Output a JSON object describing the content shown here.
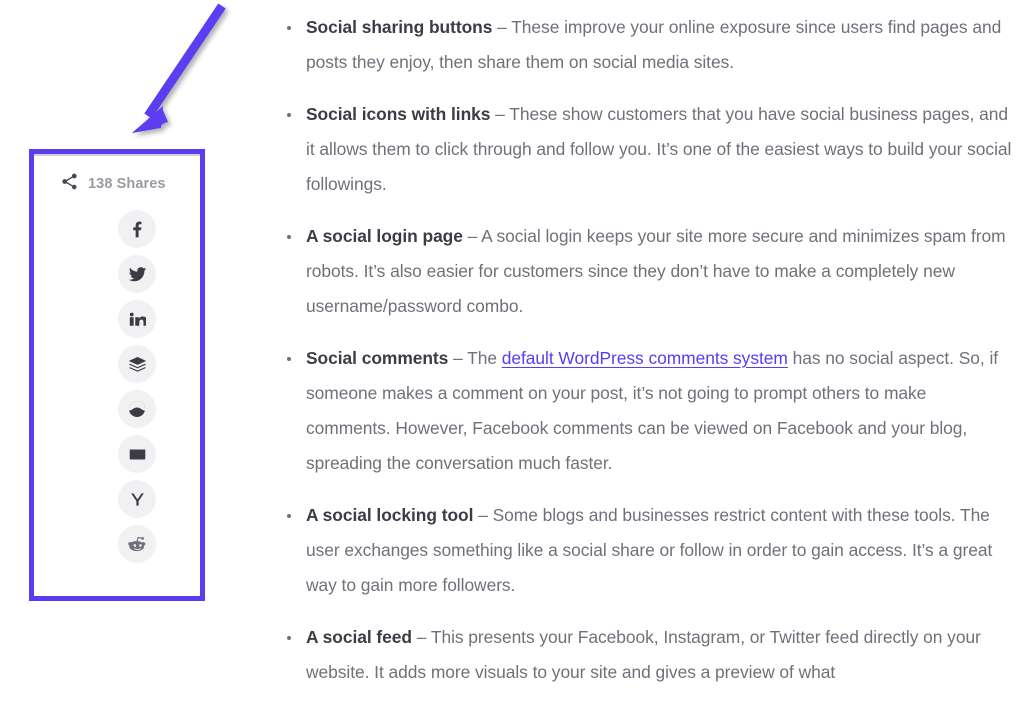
{
  "annotation": {
    "arrow_color": "#5c3cf0",
    "highlight_border_color": "#5c3cf0"
  },
  "share_widget": {
    "share_icon": "share-nodes-icon",
    "share_count_label": "138 Shares",
    "count_text_color": "#9a9aa2",
    "networks": [
      {
        "id": "facebook",
        "label": "f",
        "icon": "facebook-icon"
      },
      {
        "id": "twitter",
        "label": "",
        "icon": "twitter-bird-icon"
      },
      {
        "id": "linkedin",
        "label": "in",
        "icon": "linkedin-icon"
      },
      {
        "id": "buffer",
        "label": "",
        "icon": "buffer-layers-icon"
      },
      {
        "id": "mix",
        "label": "",
        "icon": "mix-circle-icon"
      },
      {
        "id": "email",
        "label": "",
        "icon": "envelope-icon"
      },
      {
        "id": "yummly",
        "label": "Y",
        "icon": "yummly-icon"
      },
      {
        "id": "reddit",
        "label": "",
        "icon": "reddit-alien-icon"
      }
    ]
  },
  "article": {
    "link_color": "#5c3cf0",
    "bullets": [
      {
        "term": "Social sharing buttons",
        "dash": " – ",
        "body_before_link": "These improve your online exposure since users find pages and posts they enjoy, then share them on social media sites.",
        "link_text": "",
        "body_after_link": ""
      },
      {
        "term": "Social icons with links",
        "dash": " – ",
        "body_before_link": "These show customers that you have social business pages, and it allows them to click through and follow you. It’s one of the easiest ways to build your social followings.",
        "link_text": "",
        "body_after_link": ""
      },
      {
        "term": "A social login page",
        "dash": " – ",
        "body_before_link": "A social login keeps your site more secure and minimizes spam from robots. It’s also easier for customers since they don’t have to make a completely new username/password combo.",
        "link_text": "",
        "body_after_link": ""
      },
      {
        "term": "Social comments",
        "dash": " – ",
        "body_before_link": "The ",
        "link_text": "default WordPress comments system",
        "body_after_link": " has no social aspect. So, if someone makes a comment on your post, it’s not going to prompt others to make comments. However, Facebook comments can be viewed on Facebook and your blog, spreading the conversation much faster."
      },
      {
        "term": "A social locking tool",
        "dash": " –  ",
        "body_before_link": "Some blogs and businesses restrict content with these tools. The user exchanges something like a social share or follow in order to gain access. It’s a great way to gain more followers.",
        "link_text": "",
        "body_after_link": ""
      },
      {
        "term": "A social feed",
        "dash": " – ",
        "body_before_link": "This presents your Facebook, Instagram, or Twitter feed directly on your website. It adds more visuals to your site and gives a preview of what",
        "link_text": "",
        "body_after_link": ""
      }
    ]
  }
}
